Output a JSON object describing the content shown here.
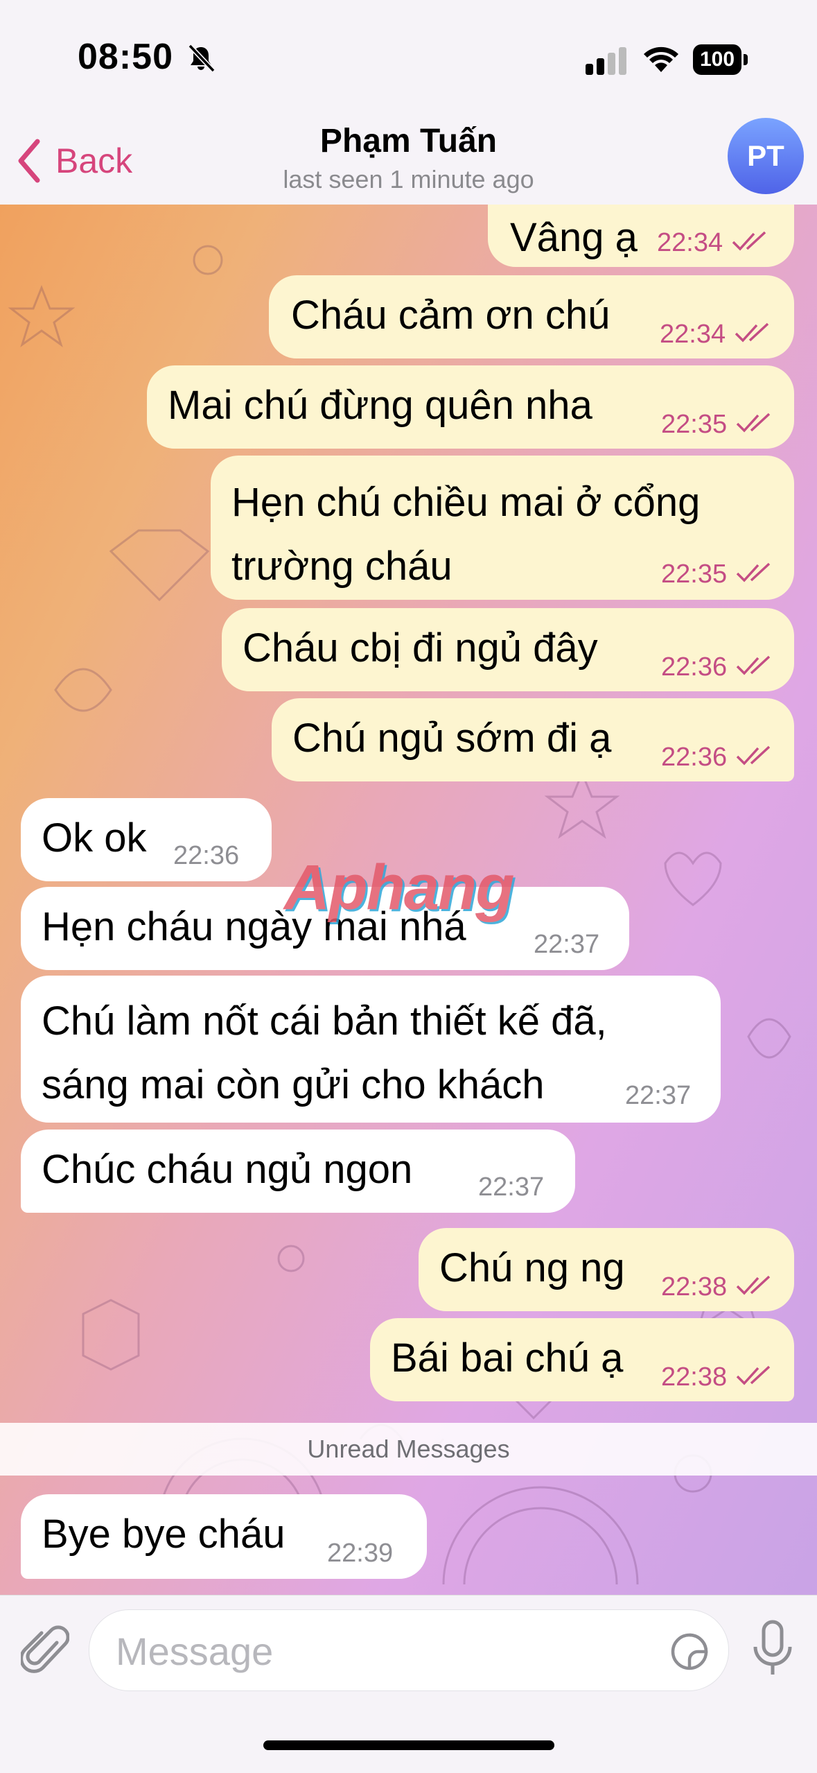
{
  "status_bar": {
    "time": "08:50",
    "battery": "100",
    "icons": [
      "bell-slash-icon",
      "signal-icon",
      "wifi-icon",
      "battery-icon"
    ]
  },
  "header": {
    "back_label": "Back",
    "contact_name": "Phạm Tuấn",
    "last_seen": "last seen 1 minute ago",
    "avatar_initials": "PT"
  },
  "watermark": "Aphang",
  "messages": [
    {
      "dir": "out",
      "text": "Vâng ạ",
      "time": "22:34"
    },
    {
      "dir": "out",
      "text": "Cháu cảm ơn chú",
      "time": "22:34"
    },
    {
      "dir": "out",
      "text": "Mai chú đừng quên nha",
      "time": "22:35"
    },
    {
      "dir": "out",
      "text": "Hẹn chú chiều mai ở cổng\ntrường cháu",
      "time": "22:35"
    },
    {
      "dir": "out",
      "text": "Cháu cbị đi ngủ đây",
      "time": "22:36"
    },
    {
      "dir": "out",
      "text": "Chú ngủ sớm đi ạ",
      "time": "22:36"
    },
    {
      "dir": "in",
      "text": "Ok ok",
      "time": "22:36"
    },
    {
      "dir": "in",
      "text": "Hẹn cháu ngày mai nhá",
      "time": "22:37"
    },
    {
      "dir": "in",
      "text": "Chú làm nốt cái bản thiết kế đã,\nsáng mai còn gửi cho khách",
      "time": "22:37"
    },
    {
      "dir": "in",
      "text": "Chúc cháu ngủ ngon",
      "time": "22:37"
    },
    {
      "dir": "out",
      "text": "Chú ng ng",
      "time": "22:38"
    },
    {
      "dir": "out",
      "text": "Bái bai chú ạ",
      "time": "22:38"
    },
    {
      "dir": "in",
      "text": "Bye bye cháu",
      "time": "22:39"
    }
  ],
  "unread_label": "Unread Messages",
  "composer": {
    "placeholder": "Message"
  },
  "colors": {
    "accent": "#d6457c",
    "outgoing_bubble": "#fdf5d0",
    "incoming_bubble": "#ffffff"
  }
}
